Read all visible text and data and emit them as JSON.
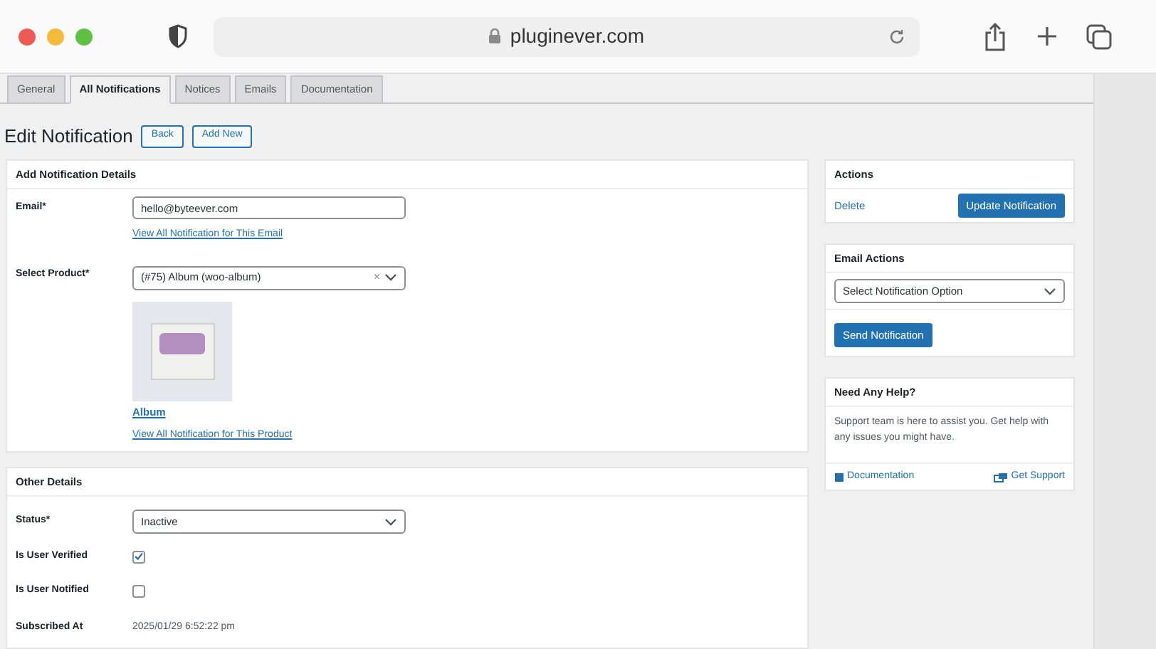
{
  "browser": {
    "url": "pluginever.com"
  },
  "tabs": [
    {
      "label": "General",
      "selected": false
    },
    {
      "label": "All Notifications",
      "selected": true
    },
    {
      "label": "Notices",
      "selected": false
    },
    {
      "label": "Emails",
      "selected": false
    },
    {
      "label": "Documentation",
      "selected": false
    }
  ],
  "page": {
    "title": "Edit Notification",
    "buttons": [
      "Back",
      "Add New"
    ]
  },
  "details": {
    "title": "Add Notification Details",
    "email": {
      "label": "Email*",
      "value": "hello@byteever.com",
      "link": "View All Notification for This Email"
    },
    "product": {
      "label": "Select Product*",
      "value": "(#75) Album (woo-album)",
      "clear": "×",
      "name": "Album",
      "link": "View All Notification for This Product"
    }
  },
  "other": {
    "title": "Other Details",
    "fields": [
      {
        "kind": "select",
        "label": "Status*",
        "value": "Inactive"
      },
      {
        "kind": "checkbox",
        "label": "Is User Verified",
        "checked": true
      },
      {
        "kind": "checkbox",
        "label": "Is User Notified",
        "checked": false
      },
      {
        "kind": "text",
        "label": "Subscribed At",
        "value": "2025/01/29 6:52:22 pm"
      }
    ]
  },
  "actions": {
    "title": "Actions",
    "delete": "Delete",
    "update": "Update Notification"
  },
  "email_actions": {
    "title": "Email Actions",
    "value": "Select Notification Option",
    "send": "Send Notification"
  },
  "help": {
    "title": "Need Any Help?",
    "text": "Support team is here to assist you. Get help with any issues you might have.",
    "links": [
      "Documentation",
      "Get Support"
    ]
  }
}
